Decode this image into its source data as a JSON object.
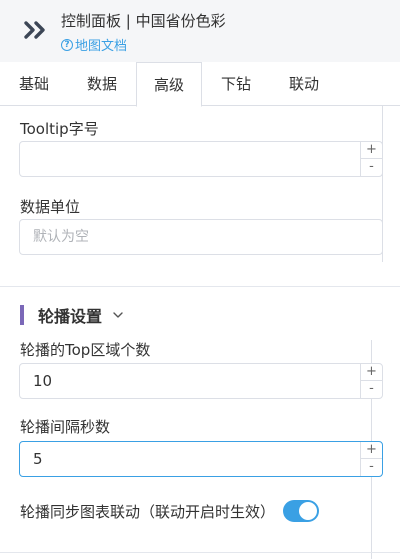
{
  "header": {
    "title": "控制面板 | 中国省份色彩",
    "doc_link": "地图文档",
    "help_glyph": "?"
  },
  "tabs": [
    {
      "label": "基础",
      "active": false
    },
    {
      "label": "数据",
      "active": false
    },
    {
      "label": "高级",
      "active": true
    },
    {
      "label": "下钻",
      "active": false
    },
    {
      "label": "联动",
      "active": false
    }
  ],
  "form": {
    "tooltip_font_size": {
      "label": "Tooltip字号",
      "value": ""
    },
    "data_unit": {
      "label": "数据单位",
      "placeholder": "默认为空",
      "value": ""
    }
  },
  "carousel": {
    "section_title": "轮播设置",
    "top_count": {
      "label": "轮播的Top区域个数",
      "value": "10"
    },
    "interval": {
      "label": "轮播间隔秒数",
      "value": "5"
    },
    "sync": {
      "label": "轮播同步图表联动（联动开启时生效）",
      "enabled": true
    }
  },
  "stepper": {
    "up": "+",
    "down": "-"
  },
  "colors": {
    "accent": "#3aa0e4",
    "section_bar": "#7b68b8"
  }
}
